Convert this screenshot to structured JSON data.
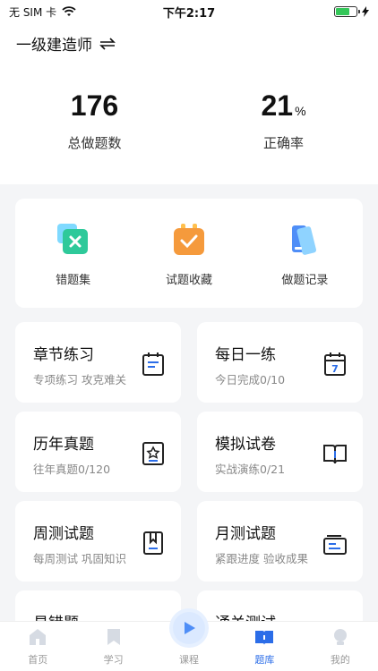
{
  "status": {
    "carrier": "无 SIM 卡",
    "time": "下午2:17",
    "battery_level": 0.7
  },
  "header": {
    "exam_name": "一级建造师",
    "stats": [
      {
        "value": "176",
        "unit": "",
        "label": "总做题数"
      },
      {
        "value": "21",
        "unit": "%",
        "label": "正确率"
      }
    ]
  },
  "quick": [
    {
      "label": "错题集",
      "icon": "wrong-set-icon"
    },
    {
      "label": "试题收藏",
      "icon": "favorites-icon"
    },
    {
      "label": "做题记录",
      "icon": "records-icon"
    }
  ],
  "cards": [
    {
      "title": "章节练习",
      "sub": "专项练习 攻克难关",
      "icon": "calendar-icon"
    },
    {
      "title": "每日一练",
      "sub": "今日完成0/10",
      "icon": "calendar-7-icon"
    },
    {
      "title": "历年真题",
      "sub": "往年真题0/120",
      "icon": "star-badge-icon"
    },
    {
      "title": "模拟试卷",
      "sub": "实战演练0/21",
      "icon": "open-book-icon"
    },
    {
      "title": "周测试题",
      "sub": "每周测试 巩固知识",
      "icon": "bookmark-icon"
    },
    {
      "title": "月测试题",
      "sub": "紧跟进度 验收成果",
      "icon": "folder-icon"
    },
    {
      "title": "易错题",
      "sub": "",
      "icon": "bulb-icon"
    },
    {
      "title": "通关测试",
      "sub": "",
      "icon": "test-icon"
    }
  ],
  "tabs": [
    {
      "label": "首页",
      "icon": "home-icon"
    },
    {
      "label": "学习",
      "icon": "study-icon"
    },
    {
      "label": "课程",
      "icon": "play-icon"
    },
    {
      "label": "题库",
      "icon": "question-bank-icon"
    },
    {
      "label": "我的",
      "icon": "profile-icon"
    }
  ],
  "colors": {
    "accent": "#2b6de8",
    "green": "#2ec99a",
    "orange": "#f59a3c"
  }
}
